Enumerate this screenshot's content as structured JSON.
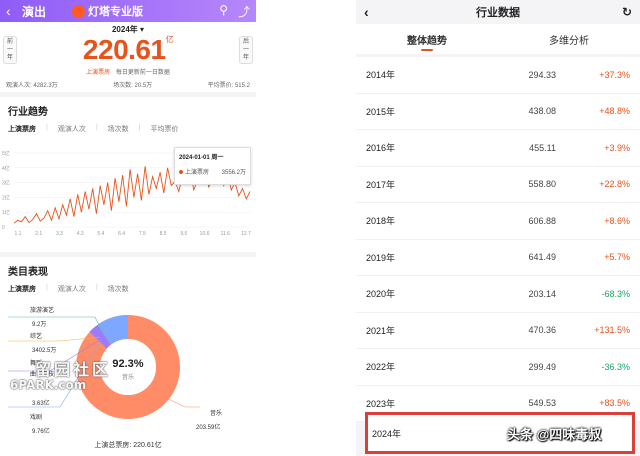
{
  "left": {
    "header": {
      "back": "‹",
      "title": "演出",
      "brand": "灯塔专业版"
    },
    "year_selector": "2024年 ▾",
    "box_office": {
      "value": "220.61",
      "unit": "亿"
    },
    "sub": {
      "label": "上演票房",
      "note": "每日更新前一日数据"
    },
    "prev": [
      "前",
      "一",
      "年"
    ],
    "next": [
      "后",
      "一",
      "年"
    ],
    "stats": [
      "观演人次: 4282.3万",
      "场次数: 20.5万",
      "平均票价: 515.2"
    ],
    "trend": {
      "title": "行业趋势",
      "tabs": [
        "上演票房",
        "观演人次",
        "场次数",
        "平均票价"
      ],
      "tooltip": {
        "date": "2024-01-01 周一",
        "series": "上演票房",
        "value": "3556.2万"
      }
    },
    "category": {
      "title": "类目表现",
      "tabs": [
        "上演票房",
        "观演人次",
        "场次数"
      ],
      "center_pct": "92.3%",
      "center_label": "音乐",
      "items": [
        {
          "name": "旅游演艺",
          "value": "9.2万"
        },
        {
          "name": "综艺",
          "value": "3402.5万"
        },
        {
          "name": "舞蹈",
          "value": ""
        },
        {
          "name": "曲艺杂技",
          "value": "3.63亿"
        },
        {
          "name": "戏剧",
          "value": "9.76亿"
        },
        {
          "name": "音乐",
          "value": "203.59亿"
        }
      ],
      "total": "上演总票房: 220.61亿"
    },
    "watermark": {
      "line1": "留园社区",
      "line2": "6PARK.com"
    }
  },
  "right": {
    "header": {
      "back": "‹",
      "title": "行业数据",
      "refresh": "↻"
    },
    "tabs": [
      "整体趋势",
      "多维分析"
    ],
    "rows": [
      {
        "year": "2014年",
        "value": "294.33",
        "change": "+37.3%"
      },
      {
        "year": "2015年",
        "value": "438.08",
        "change": "+48.8%"
      },
      {
        "year": "2016年",
        "value": "455.11",
        "change": "+3.9%"
      },
      {
        "year": "2017年",
        "value": "558.80",
        "change": "+22.8%"
      },
      {
        "year": "2018年",
        "value": "606.88",
        "change": "+8.6%"
      },
      {
        "year": "2019年",
        "value": "641.49",
        "change": "+5.7%"
      },
      {
        "year": "2020年",
        "value": "203.14",
        "change": "-68.3%"
      },
      {
        "year": "2021年",
        "value": "470.36",
        "change": "+131.5%"
      },
      {
        "year": "2022年",
        "value": "299.49",
        "change": "-36.3%"
      },
      {
        "year": "2023年",
        "value": "549.53",
        "change": "+83.5%"
      }
    ],
    "highlight_year": "2024年",
    "watermark": "头条 @四味毒叔"
  },
  "colors": {
    "accent": "#e8531c",
    "header_purple": "#9d6cf8",
    "positive": "#e8531c",
    "negative": "#1aa56a",
    "highlight_border": "#d9403a"
  },
  "chart_data": {
    "type": "line",
    "title": "行业趋势",
    "series": [
      {
        "name": "上演票房",
        "values": [
          5,
          9,
          7,
          14,
          6,
          10,
          18,
          8,
          12,
          22,
          9,
          26,
          11,
          30,
          16,
          38,
          14,
          44,
          20,
          48,
          24,
          52,
          18,
          56,
          30,
          60,
          22,
          66,
          34,
          70,
          28,
          78,
          40,
          72,
          36,
          82,
          44,
          68,
          52,
          74,
          46,
          80,
          56,
          62,
          48,
          70,
          58,
          76,
          50,
          64,
          60,
          72,
          54,
          66,
          62,
          70,
          56,
          74,
          50,
          60,
          42,
          52,
          38,
          48
        ]
      }
    ],
    "x_ticks": [
      "1.1",
      "2.1",
      "3.3",
      "4.3",
      "5.4",
      "6.4",
      "7.5",
      "8.5",
      "9.5",
      "10.6",
      "11.6",
      "12.7"
    ],
    "y_ticks": [
      "0",
      "1亿",
      "2亿",
      "3亿",
      "4亿",
      "5亿"
    ],
    "ylim": [
      0,
      100
    ]
  }
}
